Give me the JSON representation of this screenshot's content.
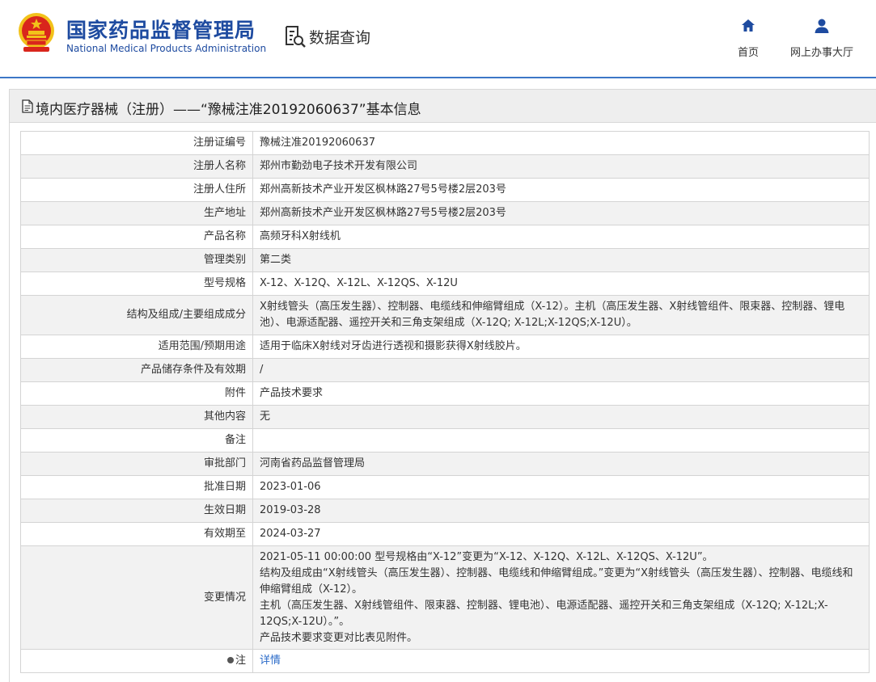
{
  "header": {
    "org_cn": "国家药品监督管理局",
    "org_en": "National Medical Products Administration",
    "query_label": "数据查询",
    "nav": {
      "home": "首页",
      "hall": "网上办事大厅"
    }
  },
  "colors": {
    "brand_blue": "#1e4ba0",
    "link_blue": "#2a6ac8",
    "row_gray": "#f2f2f2"
  },
  "page_title": "境内医疗器械（注册）——“豫械注准20192060637”基本信息",
  "rows": [
    {
      "label": "注册证编号",
      "value": "豫械注准20192060637"
    },
    {
      "label": "注册人名称",
      "value": "郑州市勤劲电子技术开发有限公司"
    },
    {
      "label": "注册人住所",
      "value": "郑州高新技术产业开发区枫林路27号5号楼2层203号"
    },
    {
      "label": "生产地址",
      "value": "郑州高新技术产业开发区枫林路27号5号楼2层203号"
    },
    {
      "label": "产品名称",
      "value": "高频牙科X射线机"
    },
    {
      "label": "管理类别",
      "value": "第二类"
    },
    {
      "label": "型号规格",
      "value": "X-12、X-12Q、X-12L、X-12QS、X-12U"
    },
    {
      "label": "结构及组成/主要组成成分",
      "value": "X射线管头（高压发生器）、控制器、电缆线和伸缩臂组成（X-12）。主机（高压发生器、X射线管组件、限束器、控制器、锂电池）、电源适配器、遥控开关和三角支架组成（X-12Q; X-12L;X-12QS;X-12U）。"
    },
    {
      "label": "适用范围/预期用途",
      "value": "适用于临床X射线对牙齿进行透视和摄影获得X射线胶片。"
    },
    {
      "label": "产品储存条件及有效期",
      "value": "/"
    },
    {
      "label": "附件",
      "value": "产品技术要求"
    },
    {
      "label": "其他内容",
      "value": "无"
    },
    {
      "label": "备注",
      "value": ""
    },
    {
      "label": "审批部门",
      "value": "河南省药品监督管理局"
    },
    {
      "label": "批准日期",
      "value": "2023-01-06"
    },
    {
      "label": "生效日期",
      "value": "2019-03-28"
    },
    {
      "label": "有效期至",
      "value": "2024-03-27"
    }
  ],
  "change": {
    "label": "变更情况",
    "lines": [
      "2021-05-11 00:00:00 型号规格由“X-12”变更为“X-12、X-12Q、X-12L、X-12QS、X-12U”。",
      "结构及组成由“X射线管头（高压发生器）、控制器、电缆线和伸缩臂组成。”变更为“X射线管头（高压发生器）、控制器、电缆线和伸缩臂组成（X-12）。",
      "主机（高压发生器、X射线管组件、限束器、控制器、锂电池）、电源适配器、遥控开关和三角支架组成（X-12Q; X-12L;X-12QS;X-12U）。”。",
      "产品技术要求变更对比表见附件。"
    ]
  },
  "note_row": {
    "label": "注",
    "link": "详情"
  }
}
